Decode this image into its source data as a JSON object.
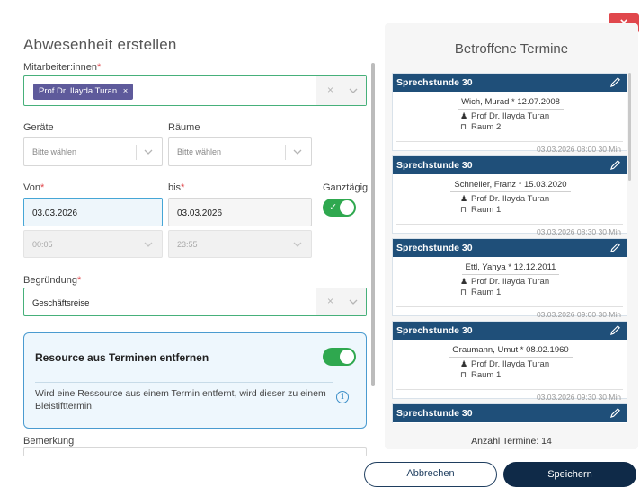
{
  "dialog": {
    "title": "Abwesenheit erstellen",
    "close_label": "×"
  },
  "employees": {
    "label": "Mitarbeiter:innen",
    "required": "*",
    "chip": "Prof Dr. Ilayda Turan",
    "chip_remove": "×",
    "clear": "×"
  },
  "devices": {
    "label": "Geräte",
    "placeholder": "Bitte wählen"
  },
  "rooms": {
    "label": "Räume",
    "placeholder": "Bitte wählen"
  },
  "from": {
    "label": "Von",
    "required": "*",
    "date": "03.03.2026",
    "time": "00:05"
  },
  "to": {
    "label": "bis",
    "required": "*",
    "date": "03.03.2026",
    "time": "23:55"
  },
  "all_day": {
    "label": "Ganztägig",
    "checked": true
  },
  "reason": {
    "label": "Begründung",
    "required": "*",
    "value": "Geschäftsreise",
    "clear": "×"
  },
  "resource": {
    "title": "Resource aus Terminen entfernen",
    "enabled": true,
    "description": "Wird eine Ressource aus einem Termin entfernt, wird dieser zu einem Bleistifttermin.",
    "info_icon": "i"
  },
  "remark": {
    "label": "Bemerkung"
  },
  "affected": {
    "title": "Betroffene Termine",
    "count_label": "Anzahl Termine: 14",
    "cards": [
      {
        "title": "Sprechstunde 30",
        "patient": "Wich, Murad * 12.07.2008",
        "doctor": "Prof Dr. Ilayda Turan",
        "room": "Raum 2",
        "footer": "03.03.2026 08:00  30 Min"
      },
      {
        "title": "Sprechstunde 30",
        "patient": "Schneller, Franz * 15.03.2020",
        "doctor": "Prof Dr. Ilayda Turan",
        "room": "Raum 1",
        "footer": "03.03.2026 08:30  30 Min"
      },
      {
        "title": "Sprechstunde 30",
        "patient": "Ettl, Yahya * 12.12.2011",
        "doctor": "Prof Dr. Ilayda Turan",
        "room": "Raum 1",
        "footer": "03.03.2026 09:00  30 Min"
      },
      {
        "title": "Sprechstunde 30",
        "patient": "Graumann, Umut * 08.02.1960",
        "doctor": "Prof Dr. Ilayda Turan",
        "room": "Raum 1",
        "footer": "03.03.2026 09:30  30 Min"
      },
      {
        "title": "Sprechstunde 30"
      }
    ]
  },
  "actions": {
    "cancel": "Abbrechen",
    "save": "Speichern"
  },
  "colors": {
    "header": "#1f4f79",
    "toggle": "#2fa84f",
    "close": "#e0474c",
    "primary": "#0f2a48"
  }
}
